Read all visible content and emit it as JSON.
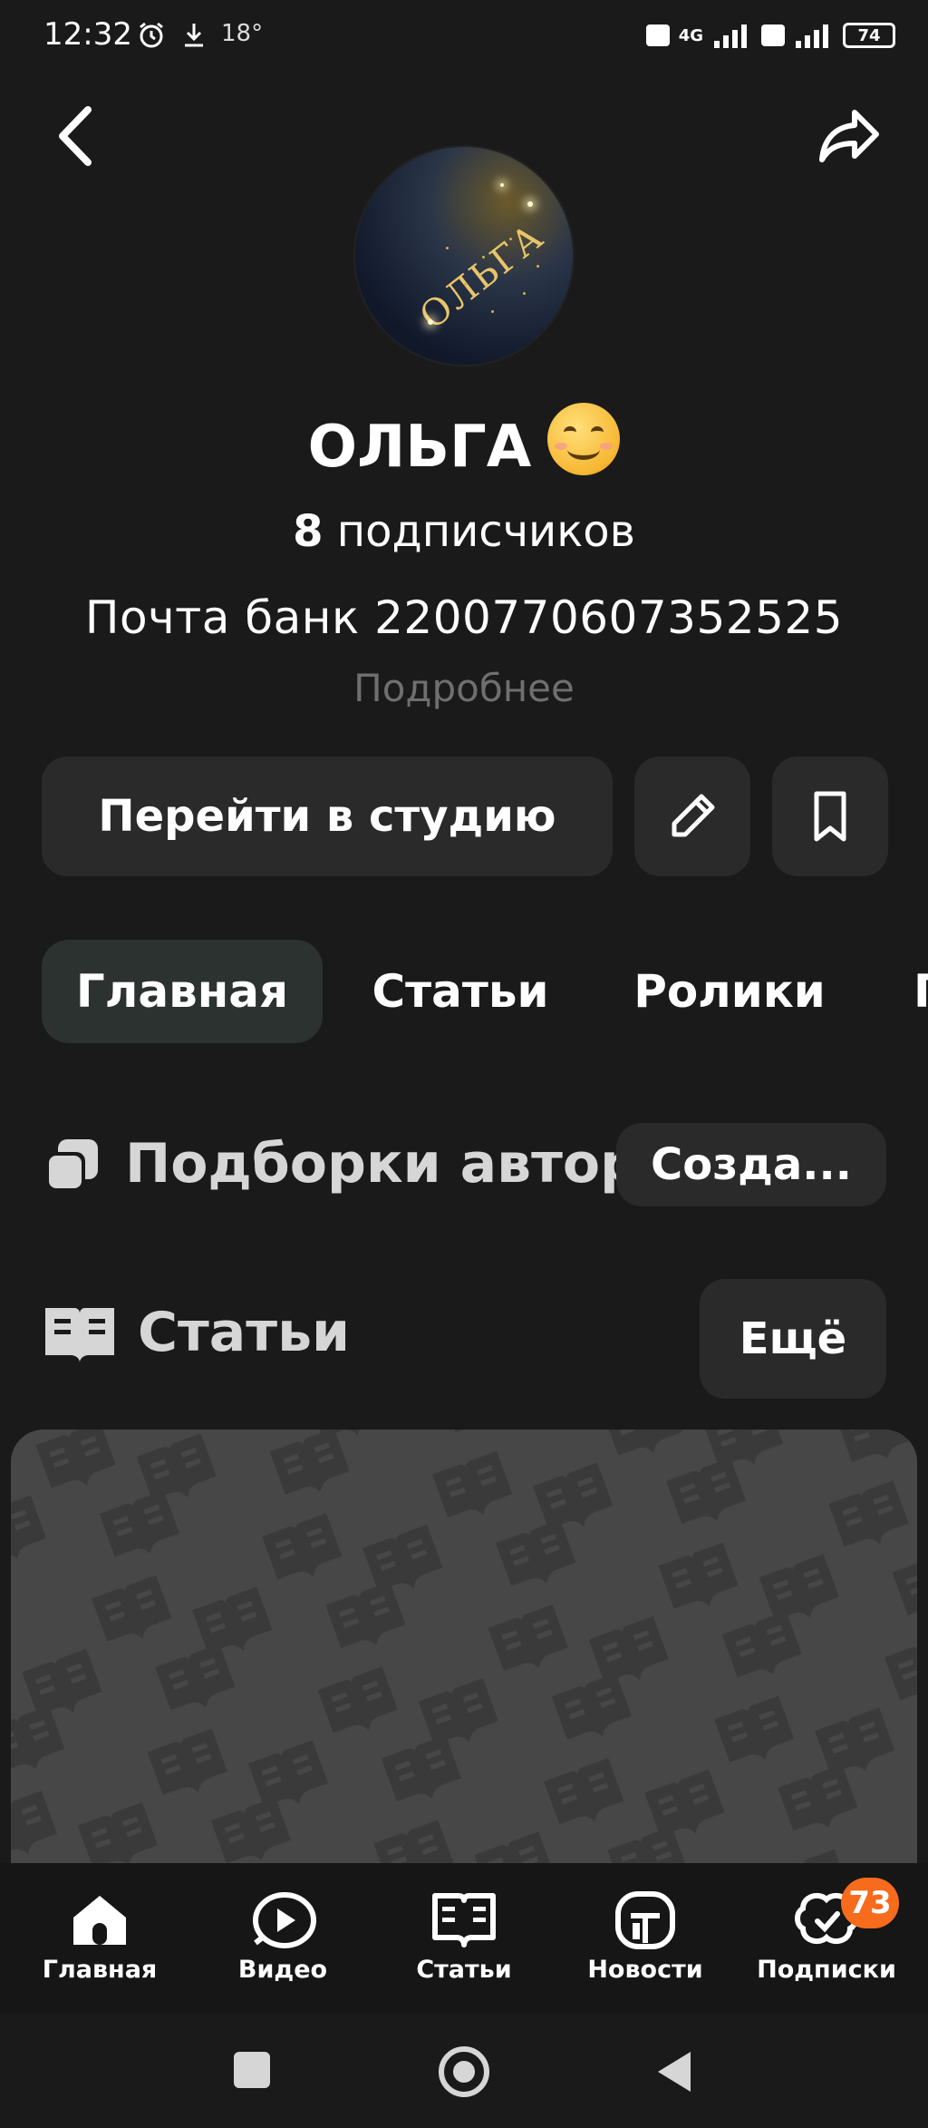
{
  "status_bar": {
    "time": "12:32",
    "temperature": "18°",
    "network": "4G",
    "battery": "74"
  },
  "profile": {
    "avatar_text": "ОЛЬГА",
    "name": "ОЛЬГА",
    "subscribers_count": "8",
    "subscribers_label": "подписчиков",
    "description": "Почта банк 2200770607352525",
    "more_link": "Подробнее"
  },
  "actions": {
    "studio_label": "Перейти в студию"
  },
  "tabs": [
    {
      "label": "Главная",
      "active": true
    },
    {
      "label": "Статьи"
    },
    {
      "label": "Ролики"
    },
    {
      "label": "П"
    }
  ],
  "sections": {
    "collections_title": "Подборки автора",
    "create_label": "Созда...",
    "articles_title": "Статьи",
    "more_label": "Ещё"
  },
  "bottom_nav": [
    {
      "label": "Главная",
      "icon": "home-icon"
    },
    {
      "label": "Видео",
      "icon": "video-icon"
    },
    {
      "label": "Статьи",
      "icon": "articles-icon"
    },
    {
      "label": "Новости",
      "icon": "news-icon"
    },
    {
      "label": "Подписки",
      "icon": "subscriptions-icon",
      "badge": "73"
    }
  ],
  "colors": {
    "background": "#1a1a1a",
    "button_bg": "#2a2a2a",
    "active_tab_bg": "#2c3230",
    "badge": "#f76b1c"
  }
}
